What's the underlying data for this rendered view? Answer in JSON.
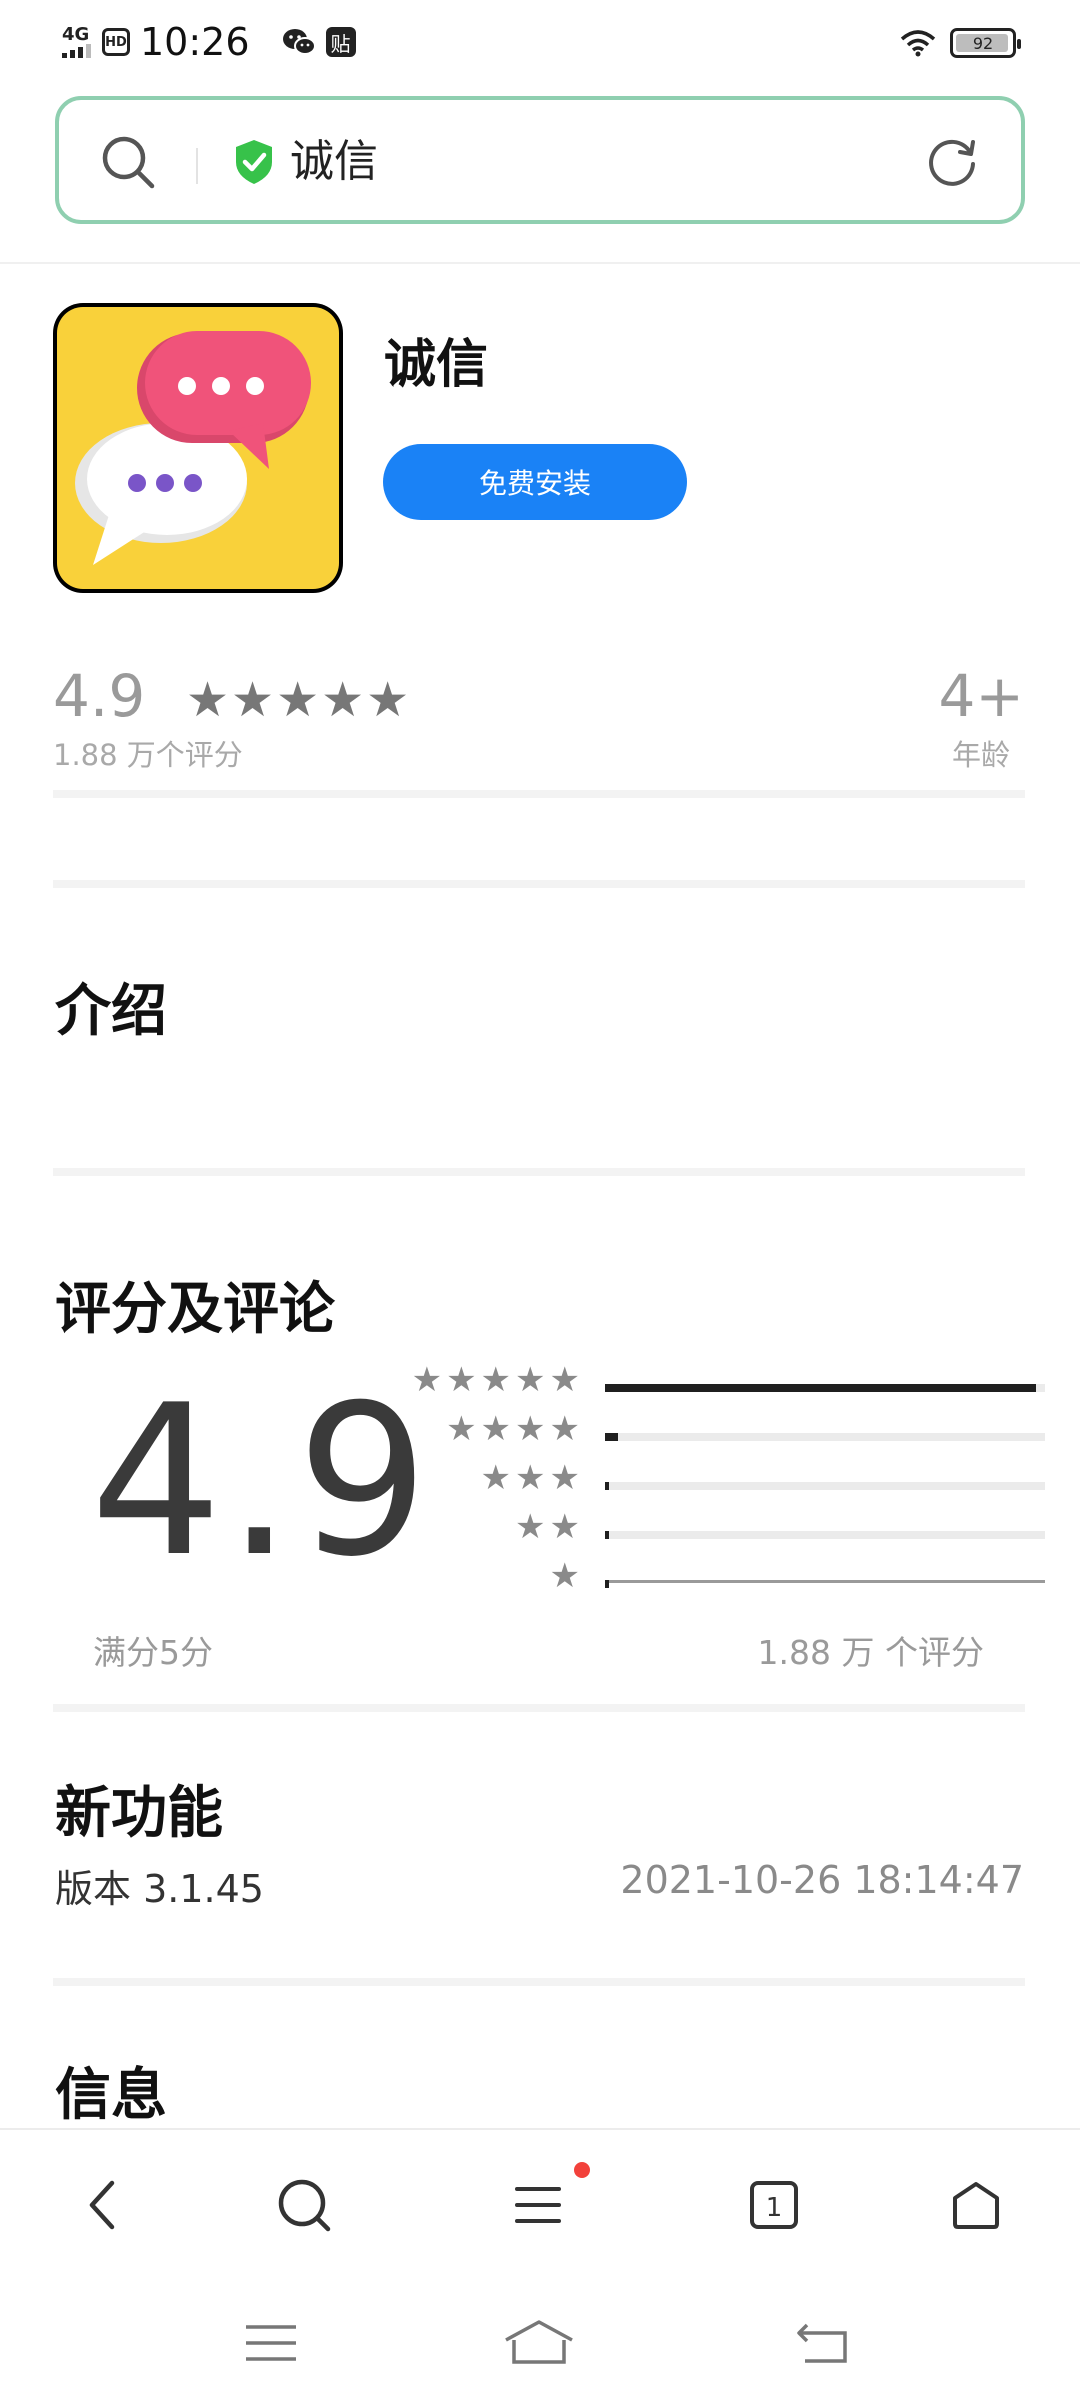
{
  "status_bar": {
    "signal": "4G",
    "hd": "HD",
    "time": "10:26",
    "note_badge": "贴",
    "battery": "92"
  },
  "search": {
    "query": "诚信"
  },
  "app": {
    "name": "诚信",
    "install_label": "免费安装",
    "rating": "4.9",
    "stars": "★★★★★",
    "rating_count": "1.88 万个评分",
    "age": "4+",
    "age_label": "年龄"
  },
  "sections": {
    "intro_title": "介绍",
    "ratings_title": "评分及评论",
    "whats_new_title": "新功能",
    "info_title": "信息"
  },
  "ratings": {
    "score": "4.9",
    "max_label": "满分5分",
    "total_label": "1.88 万 个评分",
    "distribution": [
      {
        "stars": "★★★★★",
        "fraction": 0.98
      },
      {
        "stars": "★★★★",
        "fraction": 0.03
      },
      {
        "stars": "★★★",
        "fraction": 0.005
      },
      {
        "stars": "★★",
        "fraction": 0.005
      },
      {
        "stars": "★",
        "fraction": 0.005
      }
    ]
  },
  "whats_new": {
    "version": "版本 3.1.45",
    "date": "2021-10-26 18:14:47"
  },
  "colors": {
    "accent": "#1a82f6",
    "search_border": "#8fcfb0",
    "shield": "#37c24a",
    "icon_bg": "#f9d13a",
    "bubble_pink": "#f0537a",
    "bubble_white": "#ffffff",
    "dot_purple": "#7a55c8",
    "notification_dot": "#f2413b"
  },
  "icons": {
    "search": "search-icon",
    "shield": "shield-check-icon",
    "refresh": "refresh-icon",
    "back": "chevron-left-icon",
    "menu": "menu-icon",
    "tabs": "tabs-icon",
    "home": "home-icon"
  }
}
